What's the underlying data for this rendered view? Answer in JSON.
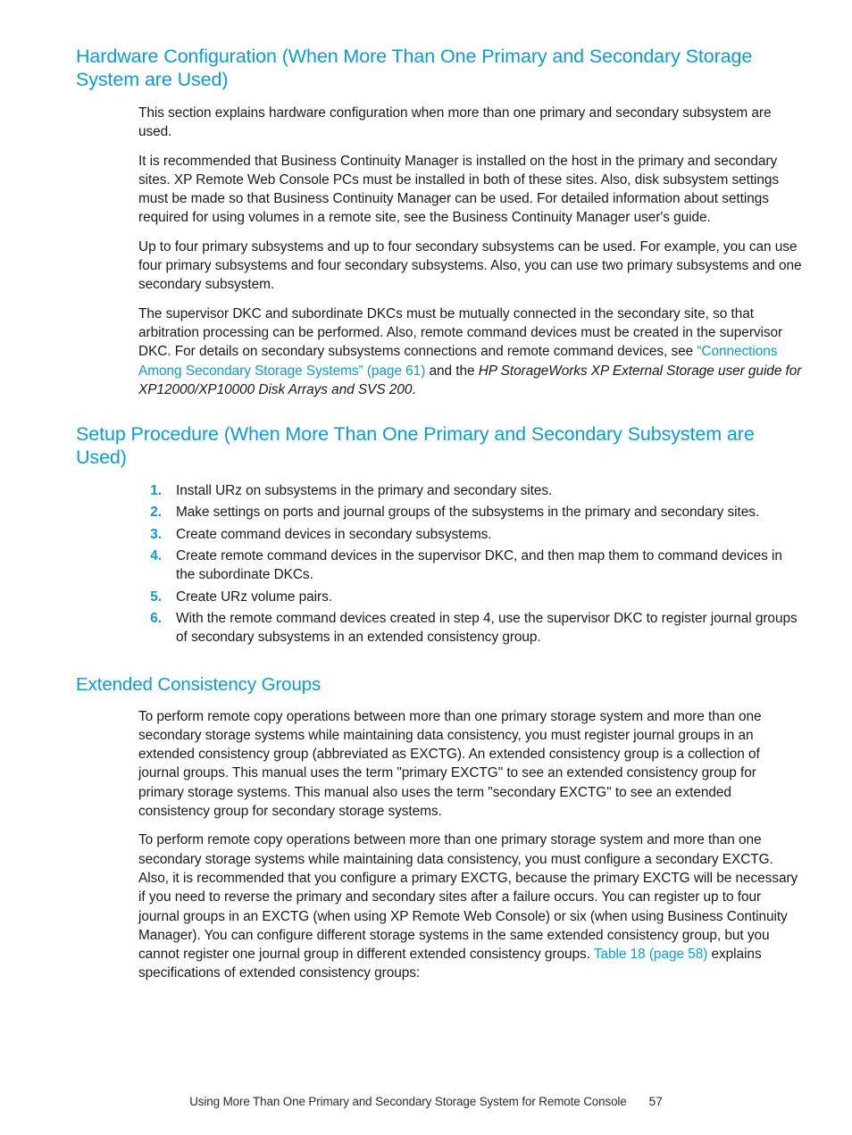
{
  "page": {
    "number": "57",
    "footer_text": "Using More Than One Primary and Secondary Storage System for Remote Console",
    "accent_color": "#0b9bd8",
    "text_color": "#1a1a1a",
    "background_color": "#ffffff"
  },
  "sections": {
    "hardware_configuration": {
      "heading": "Hardware Configuration (When More Than One Primary and Secondary Storage System are Used)",
      "paragraphs": {
        "p1": "This section explains hardware configuration when more than one primary and secondary subsystem are used.",
        "p2": "It is recommended that Business Continuity Manager is installed on the host in the primary and secondary sites. XP Remote Web Console PCs must be installed in both of these sites. Also, disk subsystem settings must be made so that Business Continuity Manager can be used. For detailed information about settings required for using volumes in a remote site, see the Business Continuity Manager user's guide.",
        "p3": "Up to four primary subsystems and up to four secondary subsystems can be used. For example, you can use four primary subsystems and four secondary subsystems. Also, you can use two primary subsystems and one secondary subsystem.",
        "p4_part1": "The supervisor DKC and subordinate DKCs must be mutually connected in the secondary site, so that arbitration processing can be performed. Also, remote command devices must be created in the supervisor DKC. For details on secondary subsystems connections and remote command devices, see ",
        "p4_link": "“Connections Among Secondary Storage Systems” (page 61)",
        "p4_part2": " and the ",
        "p4_italic": "HP StorageWorks XP External Storage user guide for XP12000/XP10000 Disk Arrays and SVS 200",
        "p4_part3": "."
      }
    },
    "setup_procedure": {
      "heading": "Setup Procedure (When More Than One Primary and Secondary Subsystem are Used)",
      "steps": [
        {
          "number": "1.",
          "text": "Install URz on subsystems in the primary and secondary sites."
        },
        {
          "number": "2.",
          "text": "Make settings on ports and journal groups of the subsystems in the primary and secondary sites."
        },
        {
          "number": "3.",
          "text": "Create command devices in secondary subsystems."
        },
        {
          "number": "4.",
          "text": "Create remote command devices in the supervisor DKC, and then map them to command devices in the subordinate DKCs."
        },
        {
          "number": "5.",
          "text": "Create URz volume pairs."
        },
        {
          "number": "6.",
          "text": "With the remote command devices created in step 4, use the supervisor DKC to register journal groups of secondary subsystems in an extended consistency group."
        }
      ]
    },
    "extended_consistency_groups": {
      "heading": "Extended Consistency Groups",
      "paragraphs": {
        "p1": "To perform remote copy operations between more than one primary storage system and more than one secondary storage systems while maintaining data consistency, you must register journal groups in an extended consistency group (abbreviated as EXCTG). An extended consistency group is a collection of journal groups. This manual uses the term \"primary EXCTG\" to see an extended consistency group for primary storage systems. This manual also uses the term \"secondary EXCTG\" to see an extended consistency group for secondary storage systems.",
        "p2_part1": "To perform remote copy operations between more than one primary storage system and more than one secondary storage systems while maintaining data consistency, you must configure a secondary EXCTG. Also, it is recommended that you configure a primary EXCTG, because the primary EXCTG will be necessary if you need to reverse the primary and secondary sites after a failure occurs. You can register up to four journal groups in an EXCTG (when using XP Remote Web Console) or six (when using Business Continuity Manager). You can configure different storage systems in the same extended consistency group, but you cannot register one journal group in different extended consistency groups. ",
        "p2_link": "Table 18 (page 58)",
        "p2_part2": " explains specifications of extended consistency groups:"
      }
    }
  }
}
